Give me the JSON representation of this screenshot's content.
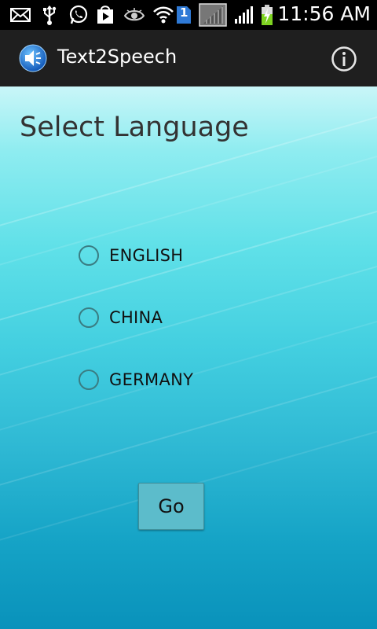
{
  "status_bar": {
    "time": "11:56 AM",
    "sim_label": "1",
    "icons": [
      "mail-icon",
      "usb-icon",
      "whatsapp-icon",
      "play-store-icon",
      "eye-icon",
      "wifi-icon",
      "sim-icon",
      "signal-no-service-icon",
      "signal-icon",
      "battery-charging-icon"
    ]
  },
  "action_bar": {
    "title": "Text2Speech",
    "app_icon": "speaker-icon",
    "info_icon": "info-icon"
  },
  "main": {
    "heading": "Select Language",
    "languages": [
      {
        "label": "ENGLISH",
        "selected": false
      },
      {
        "label": "CHINA",
        "selected": false
      },
      {
        "label": "GERMANY",
        "selected": false
      }
    ],
    "go_label": "Go"
  },
  "colors": {
    "gradient_top": "#c9f6f8",
    "gradient_bottom": "#0992bb",
    "action_bar_bg": "#1f1f1f",
    "button_bg": "#5cbccb"
  }
}
